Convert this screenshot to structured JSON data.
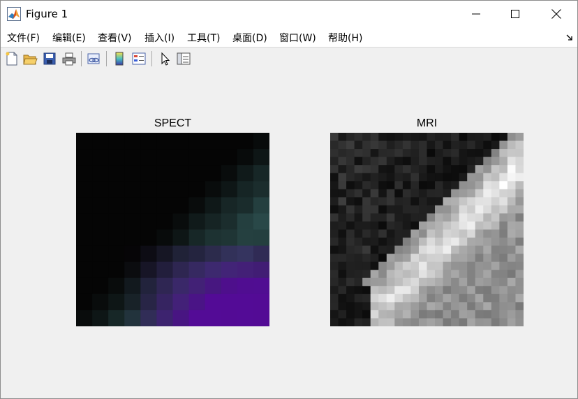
{
  "window": {
    "title": "Figure 1",
    "controls": {
      "minimize": "minimize-icon",
      "maximize": "maximize-icon",
      "close": "close-icon"
    }
  },
  "menu": {
    "items": [
      "文件(F)",
      "编辑(E)",
      "查看(V)",
      "插入(I)",
      "工具(T)",
      "桌面(D)",
      "窗口(W)",
      "帮助(H)"
    ]
  },
  "toolbar": {
    "buttons": [
      "new-figure-icon",
      "open-file-icon",
      "save-icon",
      "print-icon",
      "link-plot-icon",
      "insert-colorbar-icon",
      "insert-legend-icon",
      "edit-plot-pointer-icon",
      "property-inspector-icon"
    ]
  },
  "axes": [
    {
      "title": "SPECT",
      "colors": {
        "dark": "#050505",
        "teal": "#2a4a4a",
        "purple": "#55089a"
      }
    },
    {
      "title": "MRI",
      "colors": {
        "black": "#000000",
        "white": "#ffffff"
      }
    }
  ]
}
